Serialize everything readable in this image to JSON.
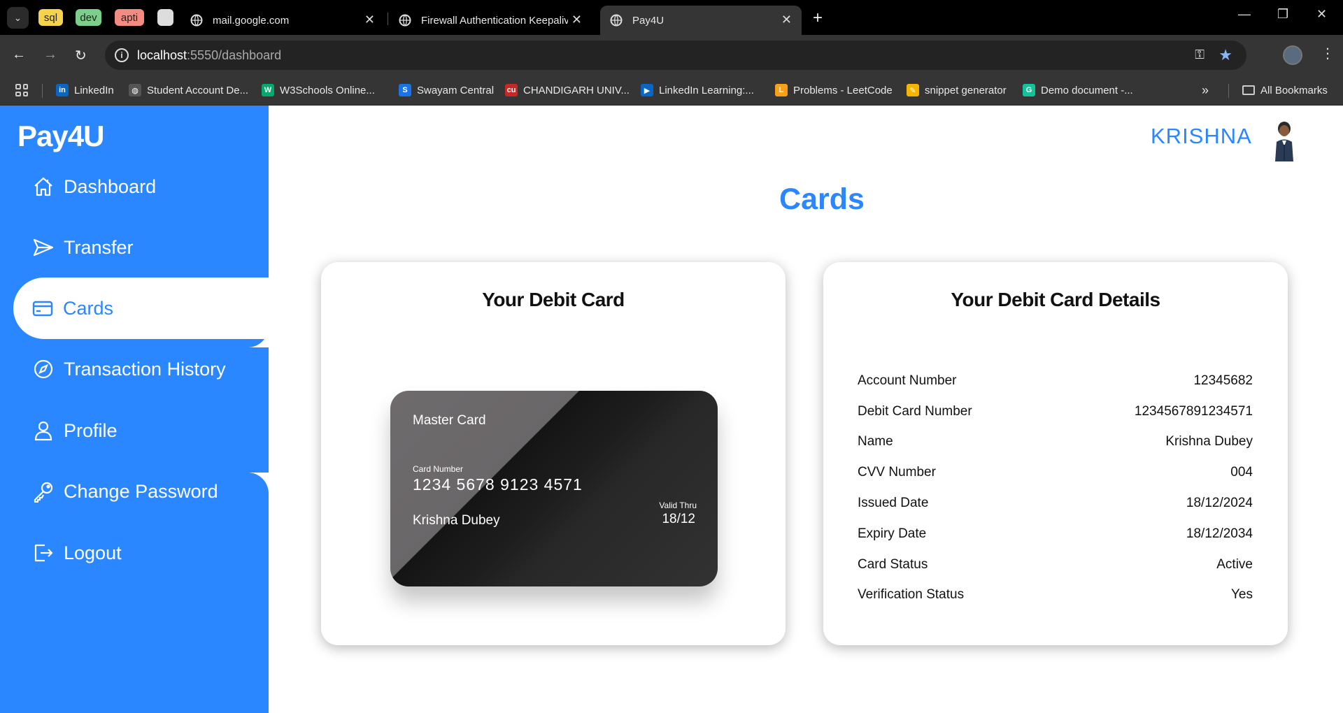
{
  "browser": {
    "tab_groups": [
      {
        "label": "sql",
        "color": "#f5d34a"
      },
      {
        "label": "dev",
        "color": "#7ccf8a"
      },
      {
        "label": "apti",
        "color": "#f28b82"
      }
    ],
    "tabs": [
      {
        "title": "mail.google.com",
        "active": false
      },
      {
        "title": "Firewall Authentication Keepalive",
        "active": false
      },
      {
        "title": "Pay4U",
        "active": true
      }
    ],
    "url_host": "localhost",
    "url_path": ":5550/dashboard",
    "bookmarks": [
      {
        "label": "LinkedIn",
        "icon": "linkedin-icon",
        "color": "#0a66c2",
        "glyph": "in"
      },
      {
        "label": "Student Account De...",
        "icon": "globe-icon",
        "color": "#555",
        "glyph": "◍"
      },
      {
        "label": "W3Schools Online...",
        "icon": "w3schools-icon",
        "color": "#04aa6d",
        "glyph": "W"
      },
      {
        "label": "Swayam Central",
        "icon": "swayam-icon",
        "color": "#1a73e8",
        "glyph": "S"
      },
      {
        "label": "CHANDIGARH UNIV...",
        "icon": "cu-icon",
        "color": "#c62828",
        "glyph": "cu"
      },
      {
        "label": "LinkedIn Learning:...",
        "icon": "linkedin-learning-icon",
        "color": "#0a66c2",
        "glyph": "▶"
      },
      {
        "label": "Problems - LeetCode",
        "icon": "leetcode-icon",
        "color": "#f89f1b",
        "glyph": "L"
      },
      {
        "label": "snippet generator",
        "icon": "snippet-icon",
        "color": "#f5b400",
        "glyph": "✎"
      },
      {
        "label": "Demo document -...",
        "icon": "grammarly-icon",
        "color": "#15c39a",
        "glyph": "G"
      }
    ],
    "all_bookmarks_label": "All Bookmarks"
  },
  "app": {
    "brand": "Pay4U",
    "username": "KRISHNA",
    "page_title": "Cards",
    "nav": [
      {
        "label": "Dashboard",
        "icon": "home-icon"
      },
      {
        "label": "Transfer",
        "icon": "send-icon"
      },
      {
        "label": "Cards",
        "icon": "credit-card-icon",
        "active": true
      },
      {
        "label": "Transaction History",
        "icon": "compass-icon"
      },
      {
        "label": "Profile",
        "icon": "user-icon"
      },
      {
        "label": "Change Password",
        "icon": "key-icon"
      },
      {
        "label": "Logout",
        "icon": "logout-icon"
      }
    ],
    "accent_color": "#2a87ff"
  },
  "card_panel": {
    "title": "Your Debit Card",
    "card": {
      "brand": "Master Card",
      "number_label": "Card Number",
      "number": "1234 5678 9123 4571",
      "holder": "Krishna Dubey",
      "valid_label": "Valid Thru",
      "valid": "18/12"
    }
  },
  "details_panel": {
    "title": "Your Debit Card Details",
    "rows": [
      {
        "label": "Account Number",
        "value": "12345682"
      },
      {
        "label": "Debit Card Number",
        "value": "1234567891234571"
      },
      {
        "label": "Name",
        "value": "Krishna Dubey"
      },
      {
        "label": "CVV Number",
        "value": "004"
      },
      {
        "label": "Issued Date",
        "value": "18/12/2024"
      },
      {
        "label": "Expiry Date",
        "value": "18/12/2034"
      },
      {
        "label": "Card Status",
        "value": "Active"
      },
      {
        "label": "Verification Status",
        "value": "Yes"
      }
    ]
  }
}
